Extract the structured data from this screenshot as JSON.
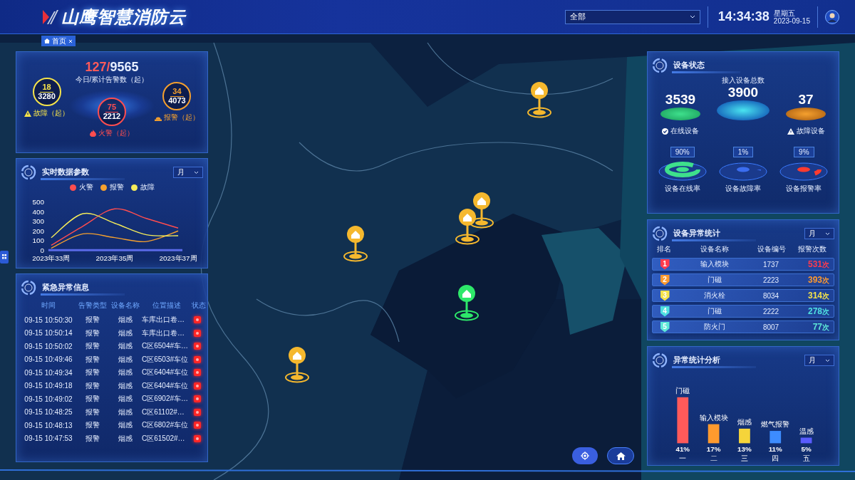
{
  "header": {
    "title": "山鹰智慧消防云",
    "region_select": {
      "value": "全部"
    },
    "time": "14:34:38",
    "weekday": "星期五",
    "date": "2023-09-15"
  },
  "tabs": [
    {
      "label": "首页",
      "selected": true
    }
  ],
  "map": {
    "kind": "picture",
    "pins": [
      {
        "color": "#f5b82e"
      },
      {
        "color": "#f5b82e"
      },
      {
        "color": "#f5b82e"
      },
      {
        "color": "#f5b82e"
      },
      {
        "color": "#f5b82e"
      },
      {
        "color": "#2ee86a"
      }
    ]
  },
  "alarm_summary": {
    "today": "127",
    "separator": "/",
    "total": "9565",
    "caption": "今日/累计告警数（起）",
    "categories": [
      {
        "kind": "fault",
        "today": "18",
        "total": "3280",
        "label": "故障（起）",
        "color": "#f5e34a"
      },
      {
        "kind": "fire",
        "today": "75",
        "total": "2212",
        "label": "火警（起）",
        "color": "#ff4d4f"
      },
      {
        "kind": "alarm",
        "today": "34",
        "total": "4073",
        "label": "报警（起）",
        "color": "#f5a02e"
      }
    ]
  },
  "realtime_params": {
    "title": "实时数据参数",
    "period": "月",
    "chart_data": {
      "type": "line",
      "categories": [
        "2023年33周",
        null,
        "2023年35周",
        null,
        "2023年37周"
      ],
      "ylim": [
        0,
        500
      ],
      "yticks": [
        0,
        100,
        200,
        300,
        400,
        500
      ],
      "series": [
        {
          "name": "火警",
          "color": "#ff4d4f",
          "values": [
            50,
            250,
            430,
            330,
            230
          ]
        },
        {
          "name": "报警",
          "color": "#f5a02e",
          "values": [
            20,
            170,
            130,
            90,
            200
          ]
        },
        {
          "name": "故障",
          "color": "#f5ec5a",
          "values": [
            130,
            380,
            280,
            160,
            150
          ]
        }
      ]
    }
  },
  "emergency_info": {
    "title": "紧急异常信息",
    "columns": [
      "时间",
      "告警类型",
      "设备名称",
      "位置描述",
      "状态"
    ],
    "rows": [
      {
        "time": "09-15 10:50:30",
        "type": "报警",
        "device": "烟感",
        "location": "车库出口卷…",
        "color": "#ff2626"
      },
      {
        "time": "09-15 10:50:14",
        "type": "报警",
        "device": "烟感",
        "location": "车库出口卷…",
        "color": "#ff2626"
      },
      {
        "time": "09-15 10:50:02",
        "type": "报警",
        "device": "烟感",
        "location": "C区6504#车…",
        "color": "#ff2626"
      },
      {
        "time": "09-15 10:49:46",
        "type": "报警",
        "device": "烟感",
        "location": "C区6503#车位",
        "color": "#ff2626"
      },
      {
        "time": "09-15 10:49:34",
        "type": "报警",
        "device": "烟感",
        "location": "C区6404#车位",
        "color": "#ff2626"
      },
      {
        "time": "09-15 10:49:18",
        "type": "报警",
        "device": "烟感",
        "location": "C区6404#车位",
        "color": "#ff2626"
      },
      {
        "time": "09-15 10:49:02",
        "type": "报警",
        "device": "烟感",
        "location": "C区6902#车…",
        "color": "#ff2626"
      },
      {
        "time": "09-15 10:48:25",
        "type": "报警",
        "device": "烟感",
        "location": "C区61102#…",
        "color": "#ff2626"
      },
      {
        "time": "09-15 10:48:13",
        "type": "报警",
        "device": "烟感",
        "location": "C区6802#车位",
        "color": "#ff2626"
      },
      {
        "time": "09-15 10:47:53",
        "type": "报警",
        "device": "烟感",
        "location": "C区61502#…",
        "color": "#ff2626"
      }
    ]
  },
  "device_status": {
    "title": "设备状态",
    "total_label": "接入设备总数",
    "total": "3900",
    "online": "3539",
    "online_label": "在线设备",
    "fault": "37",
    "fault_label": "故障设备",
    "rates": [
      {
        "value": "90%",
        "label": "设备在线率",
        "color": "#3ee08c"
      },
      {
        "value": "1%",
        "label": "设备故障率",
        "color": "#3b6df0"
      },
      {
        "value": "9%",
        "label": "设备报警率",
        "color": "#ff3b30"
      }
    ]
  },
  "anomaly_ranking": {
    "title": "设备异常统计",
    "period": "月",
    "columns": [
      "排名",
      "设备名称",
      "设备编号",
      "报警次数"
    ],
    "rows": [
      {
        "rank": "1",
        "name": "输入模块",
        "code": "1737",
        "count": "531",
        "unit": "次",
        "color": "#ff3b4e"
      },
      {
        "rank": "2",
        "name": "门磁",
        "code": "2223",
        "count": "393",
        "unit": "次",
        "color": "#ff9a2e"
      },
      {
        "rank": "3",
        "name": "消火栓",
        "code": "8034",
        "count": "314",
        "unit": "次",
        "color": "#f5e34a"
      },
      {
        "rank": "4",
        "name": "门磁",
        "code": "2222",
        "count": "278",
        "unit": "次",
        "color": "#4fe0e0"
      },
      {
        "rank": "5",
        "name": "防火门",
        "code": "8007",
        "count": "77",
        "unit": "次",
        "color": "#5ee8d8"
      }
    ]
  },
  "anomaly_analysis": {
    "title": "异常统计分析",
    "period": "月",
    "bar_names": [
      "门磁",
      "输入模块",
      "烟感",
      "燃气报警",
      "温感"
    ],
    "chart_data": {
      "type": "bar",
      "categories": [
        "一",
        "二",
        "三",
        "四",
        "五"
      ],
      "values": [
        41,
        17,
        13,
        11,
        5
      ],
      "value_labels": [
        "41%",
        "17%",
        "13%",
        "11%",
        "5%"
      ]
    }
  }
}
